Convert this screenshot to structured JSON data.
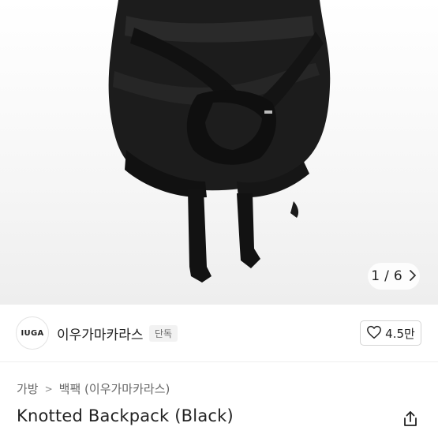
{
  "gallery": {
    "current": "1",
    "separator": "/",
    "total": "6"
  },
  "seller": {
    "logo_text": "IUGA",
    "name": "이우가마카라스",
    "badge": "단독"
  },
  "like": {
    "count": "4.5만",
    "icon": "heart-outline-icon"
  },
  "breadcrumb": {
    "items": [
      "가방",
      "백팩 (이우가마카라스)"
    ],
    "separator": ">"
  },
  "product": {
    "title": "Knotted Backpack (Black)"
  },
  "icons": {
    "share": "share-icon",
    "next": "chevron-right-icon"
  }
}
